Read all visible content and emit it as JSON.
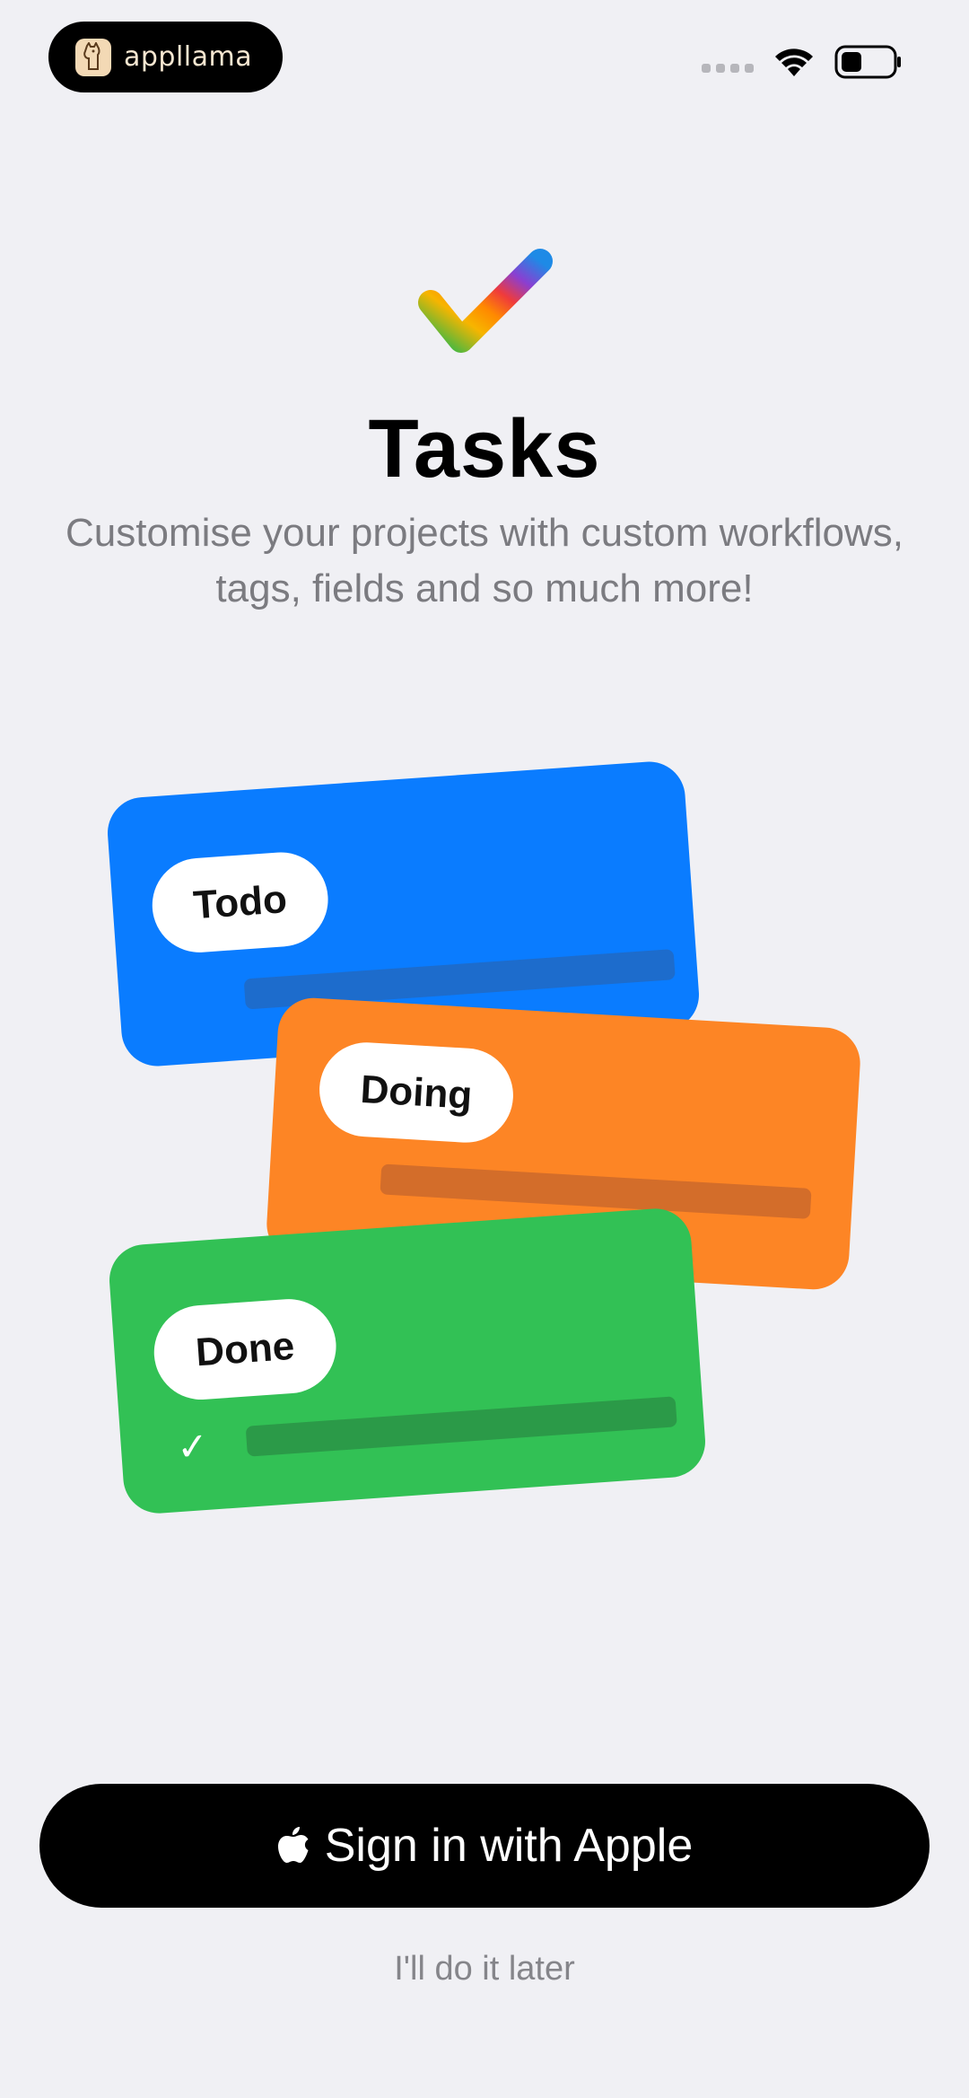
{
  "status_bar": {
    "brand_name": "appllama",
    "icons": [
      "cellular-dots-icon",
      "wifi-icon",
      "battery-icon"
    ]
  },
  "hero": {
    "icon": "rainbow-check-icon",
    "title": "Tasks",
    "subtitle": "Customise your projects with custom workflows, tags, fields and so much more!"
  },
  "cards": [
    {
      "label": "Todo",
      "color": "#0a7cff"
    },
    {
      "label": "Doing",
      "color": "#fd8525"
    },
    {
      "label": "Done",
      "color": "#32c155",
      "check": "✓"
    }
  ],
  "actions": {
    "sign_in_label": "Sign in with Apple",
    "later_label": "I'll do it later"
  },
  "colors": {
    "background": "#f0f0f4",
    "button": "#000000",
    "secondary_text": "#7b7b80"
  }
}
